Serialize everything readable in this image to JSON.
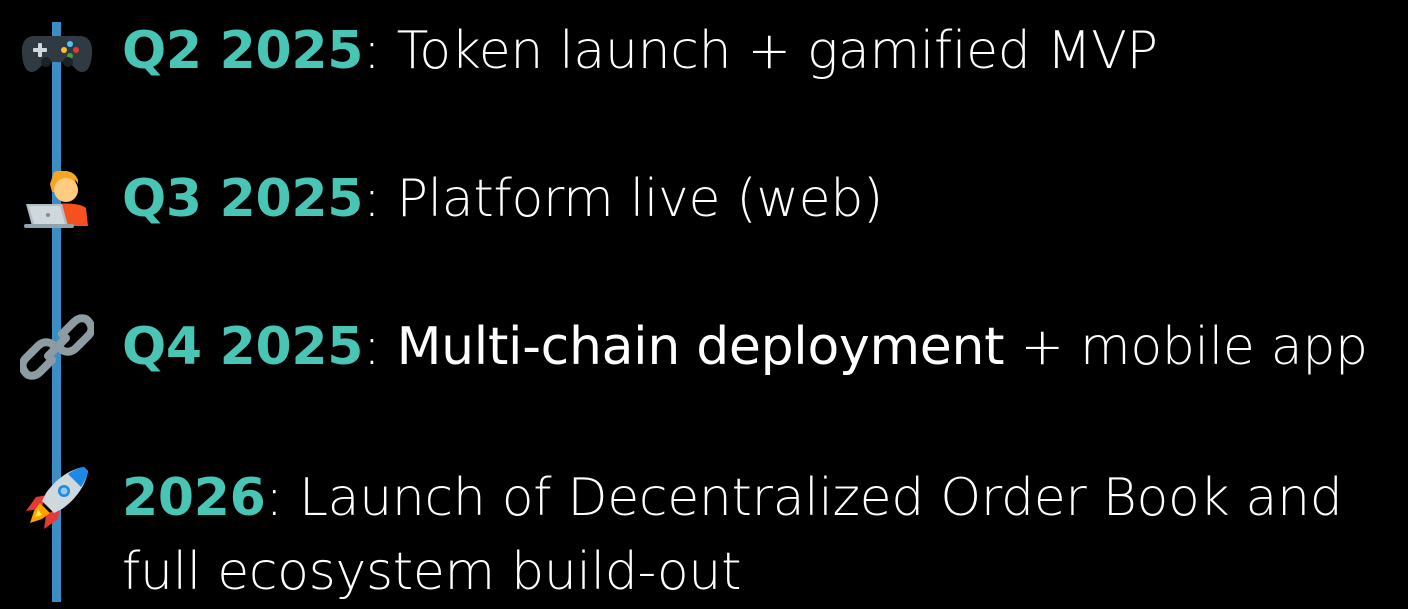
{
  "colors": {
    "background": "#000000",
    "accent_date": "#49c5b5",
    "timeline": "#3b8ec3",
    "text": "#ffffff"
  },
  "milestones": [
    {
      "icon": "game-controller-icon",
      "date": "Q2 2025",
      "separator": ":",
      "text": " Token launch + gamified MVP"
    },
    {
      "icon": "person-laptop-icon",
      "date": "Q3 2025",
      "separator": ":",
      "text": " Platform live (web)"
    },
    {
      "icon": "link-icon",
      "date": "Q4 2025",
      "separator": ":",
      "highlight": " Multi-chain deployment",
      "text": " + mobile app"
    },
    {
      "icon": "rocket-icon",
      "date": "2026",
      "separator": ":",
      "text": " Launch of Decentralized Order Book and full ecosystem build-out"
    }
  ]
}
